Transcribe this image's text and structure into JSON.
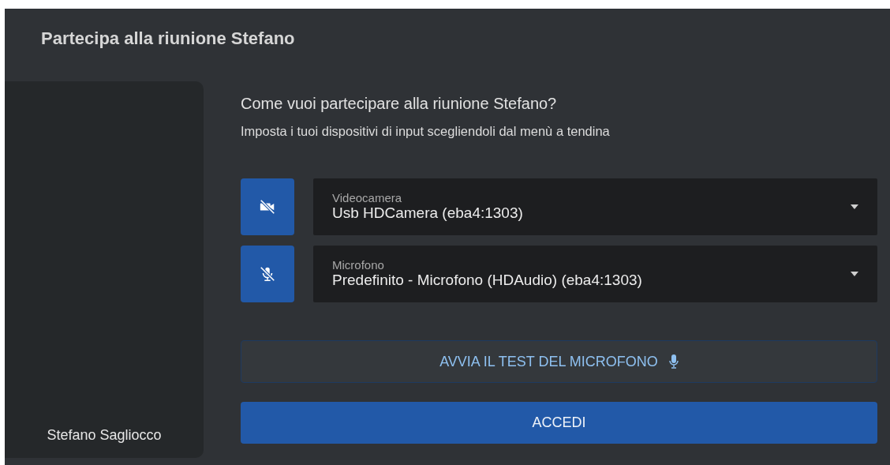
{
  "dialog": {
    "title": "Partecipa alla riunione Stefano"
  },
  "preview": {
    "name": "Stefano Sagliocco"
  },
  "prompt": {
    "question": "Come vuoi partecipare alla riunione Stefano?",
    "hint": "Imposta i tuoi dispositivi di input scegliendoli dal menù a tendina"
  },
  "devices": [
    {
      "kind": "camera",
      "muted": true,
      "label": "Videocamera",
      "value": "Usb HDCamera (eba4:1303)"
    },
    {
      "kind": "microphone",
      "muted": true,
      "label": "Microfono",
      "value": "Predefinito - Microfono (HDAudio) (eba4:1303)"
    }
  ],
  "test_button": {
    "label": "AVVIA IL TEST DEL MICROFONO"
  },
  "join_button": {
    "label": "ACCEDI"
  }
}
